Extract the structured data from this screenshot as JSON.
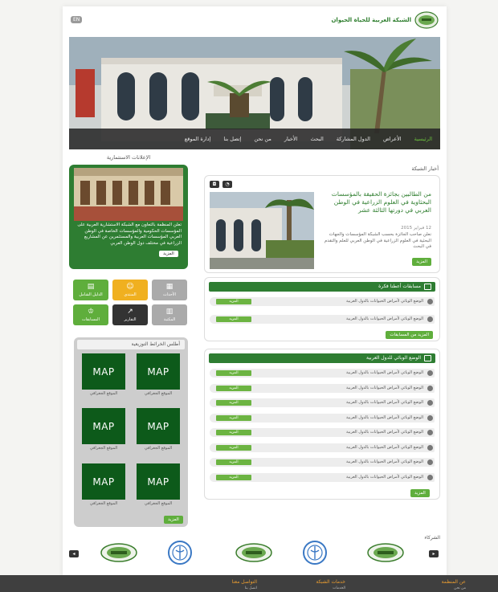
{
  "header": {
    "site_title": "الشبكة العربية للحياة الحيوان",
    "lang_label": "EN"
  },
  "nav": {
    "items": [
      "الرئيسية",
      "الأعراض",
      "الدول المشاركة",
      "البحث",
      "الأخبار",
      "من نحن",
      "إتصل بنا",
      "إدارة الموقع"
    ]
  },
  "news": {
    "section_title": "أخبار الشبكة",
    "title": "من الطالبين بجائزة الحقيقة بالمؤسسات البحثاوية في العلوم الزراعية في الوطن العربي في دورتها الثالثة عشر",
    "date": "12 فبراير 2015",
    "body": "نعلن صاحب الجائزة بحسب الشبكة المؤسسات والجهات البحثية في العلوم الزراعية في الوطن العربي للعلم والتقدم في البحث",
    "more_label": "المزيد"
  },
  "announce": {
    "title": "الإعلانات الاستثمارية",
    "text": "تعلن المنظمة بالتعاون مع الشبكة الاستشارية العربية على المؤسسات الحكومية والمؤسسات الخاصة في الوطن العربي المؤسسات العربية والمستثمرين عن المشاريع الزراعية في مختلف دول الوطن العربي",
    "more_label": "المزيد"
  },
  "services": [
    {
      "label": "الدليل الشامل",
      "color": "#5fae3c",
      "icon": "book-icon",
      "glyph": "▤"
    },
    {
      "label": "المنتدى",
      "color": "#f0b020",
      "icon": "people-icon",
      "glyph": "☺"
    },
    {
      "label": "الأحداث",
      "color": "#aaaaaa",
      "icon": "calendar-icon",
      "glyph": "▦"
    },
    {
      "label": "المسابقات",
      "color": "#5fae3c",
      "icon": "trophy-icon",
      "glyph": "♔"
    },
    {
      "label": "التقارير",
      "color": "#333333",
      "icon": "chart-icon",
      "glyph": "↗"
    },
    {
      "label": "المكتبة",
      "color": "#aaaaaa",
      "icon": "library-icon",
      "glyph": "▥"
    }
  ],
  "maps": {
    "title": "أطلس الخرائط التوزيعية",
    "tile_label": "MAP",
    "captions": [
      "الموقع الجغرافي",
      "الموقع الجغرافي",
      "الموقع الجغرافي",
      "الموقع الجغرافي",
      "الموقع الجغرافي",
      "الموقع الجغرافي"
    ],
    "more_label": "المزيد"
  },
  "competitions": {
    "title": "مسابقات أعطنا فكرة",
    "rows": [
      {
        "text": "الوضع الوبائي لأمراض الحيوانات بالدول العربية",
        "btn": "المزيد"
      },
      {
        "text": "الوضع الوبائي لأمراض الحيوانات بالدول العربية",
        "btn": "المزيد"
      }
    ],
    "more_label": "المزيد من المسابقات"
  },
  "epidemic": {
    "title": "الوضع الوبائي للدول العربية",
    "rows": [
      {
        "text": "الوضع الوبائي لأمراض الحيوانات بالدول العربية",
        "btn": "المزيد"
      },
      {
        "text": "الوضع الوبائي لأمراض الحيوانات بالدول العربية",
        "btn": "المزيد"
      },
      {
        "text": "الوضع الوبائي لأمراض الحيوانات بالدول العربية",
        "btn": "المزيد"
      },
      {
        "text": "الوضع الوبائي لأمراض الحيوانات بالدول العربية",
        "btn": "المزيد"
      },
      {
        "text": "الوضع الوبائي لأمراض الحيوانات بالدول العربية",
        "btn": "المزيد"
      },
      {
        "text": "الوضع الوبائي لأمراض الحيوانات بالدول العربية",
        "btn": "المزيد"
      },
      {
        "text": "الوضع الوبائي لأمراض الحيوانات بالدول العربية",
        "btn": "المزيد"
      },
      {
        "text": "الوضع الوبائي لأمراض الحيوانات بالدول العربية",
        "btn": "المزيد"
      }
    ],
    "more_label": "المزيد"
  },
  "partners": {
    "title": "الشركاء"
  },
  "footer": {
    "cols": [
      {
        "title": "عن المنظمة",
        "sub": "من نحن"
      },
      {
        "title": "خدمات الشبكة",
        "sub": "الخدمات"
      },
      {
        "title": "التواصل معنا",
        "sub": "اتصل بنا"
      }
    ]
  },
  "colors": {
    "brand_green": "#2e7d32",
    "accent_green": "#5fae3c",
    "footer_bg": "#3f3f3f",
    "footer_text": "#f0a030"
  }
}
